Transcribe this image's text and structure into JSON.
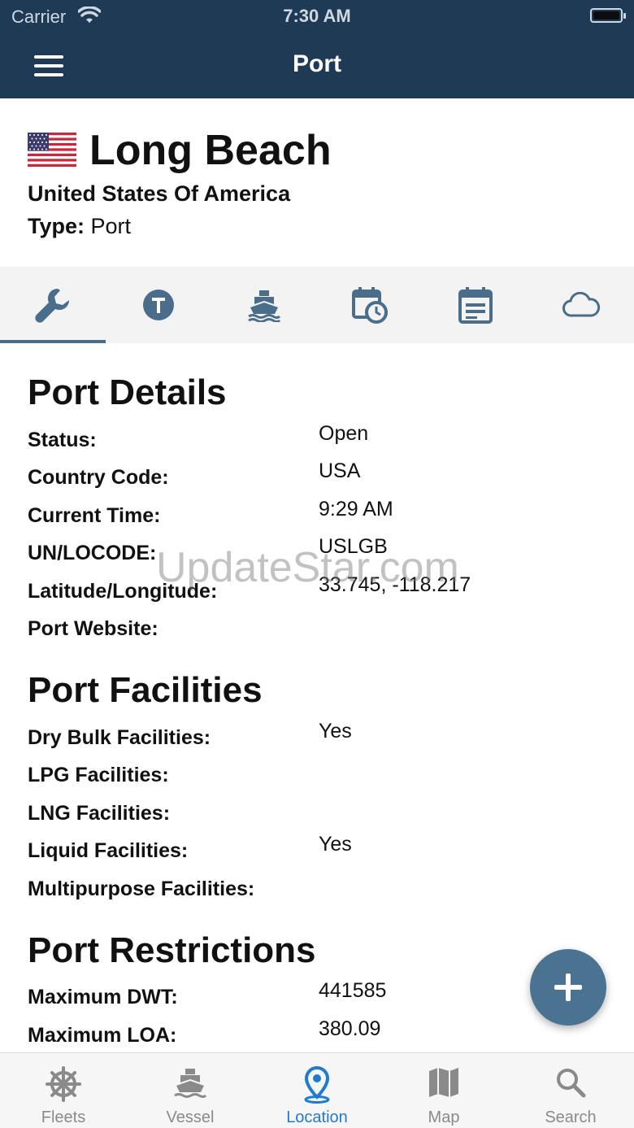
{
  "status_bar": {
    "carrier": "Carrier",
    "time": "7:30 AM"
  },
  "nav": {
    "title": "Port"
  },
  "header": {
    "port_name": "Long Beach",
    "country": "United States Of America",
    "type_label": "Type:",
    "type_value": "Port"
  },
  "tabs": [
    {
      "icon": "wrench-icon",
      "active": true
    },
    {
      "icon": "t-circle-icon",
      "active": false
    },
    {
      "icon": "ship-icon",
      "active": false
    },
    {
      "icon": "calendar-clock-icon",
      "active": false
    },
    {
      "icon": "calendar-list-icon",
      "active": false
    },
    {
      "icon": "cloud-icon",
      "active": false
    }
  ],
  "port_details": {
    "title": "Port Details",
    "rows": [
      {
        "label": "Status:",
        "value": "Open"
      },
      {
        "label": "Country Code:",
        "value": "USA"
      },
      {
        "label": "Current Time:",
        "value": "9:29 AM"
      },
      {
        "label": "UN/LOCODE:",
        "value": "USLGB"
      },
      {
        "label": "Latitude/Longitude:",
        "value": "33.745, -118.217"
      },
      {
        "label": "Port Website:",
        "value": ""
      }
    ]
  },
  "port_facilities": {
    "title": "Port Facilities",
    "rows": [
      {
        "label": "Dry Bulk Facilities:",
        "value": "Yes"
      },
      {
        "label": "LPG Facilities:",
        "value": ""
      },
      {
        "label": "LNG Facilities:",
        "value": ""
      },
      {
        "label": "Liquid Facilities:",
        "value": "Yes"
      },
      {
        "label": "Multipurpose Facilities:",
        "value": ""
      }
    ]
  },
  "port_restrictions": {
    "title": "Port Restrictions",
    "rows": [
      {
        "label": "Maximum DWT:",
        "value": "441585"
      },
      {
        "label": "Maximum LOA:",
        "value": "380.09"
      }
    ]
  },
  "watermark": "UpdateStar.com",
  "bottom_tabs": [
    {
      "label": "Fleets",
      "icon": "ship-wheel-icon"
    },
    {
      "label": "Vessel",
      "icon": "ship-icon"
    },
    {
      "label": "Location",
      "icon": "location-pin-icon",
      "active": true
    },
    {
      "label": "Map",
      "icon": "map-icon"
    },
    {
      "label": "Search",
      "icon": "search-icon"
    }
  ],
  "colors": {
    "nav_bg": "#1e3a55",
    "accent": "#4a6d8c",
    "active_tab": "#1f7ad1",
    "fab": "#4a7391"
  }
}
